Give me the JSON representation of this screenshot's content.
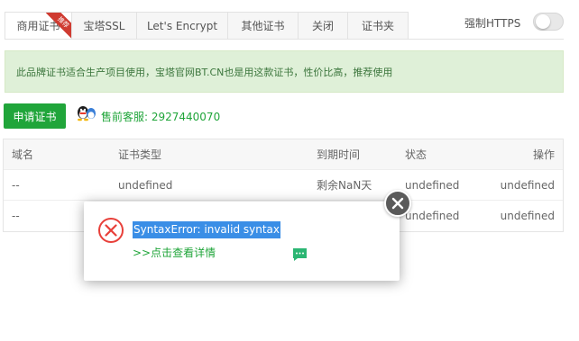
{
  "tabs": [
    {
      "label": "商用证书",
      "badge": "推荐",
      "active": true
    },
    {
      "label": "宝塔SSL"
    },
    {
      "label": "Let's Encrypt"
    },
    {
      "label": "其他证书"
    },
    {
      "label": "关闭"
    },
    {
      "label": "证书夹"
    }
  ],
  "https": {
    "label": "强制HTTPS",
    "enabled": false
  },
  "notice": "此品牌证书适合生产项目使用，宝塔官网BT.CN也是用这款证书，性价比高，推荐使用",
  "apply_button": "申请证书",
  "support": "售前客服: 2927440070",
  "table": {
    "headers": [
      "域名",
      "证书类型",
      "到期时间",
      "状态",
      "操作"
    ],
    "rows": [
      [
        "--",
        "undefined",
        "剩余NaN天",
        "undefined",
        "undefined"
      ],
      [
        "--",
        "",
        "",
        "undefined",
        "undefined"
      ]
    ]
  },
  "modal": {
    "error": "SyntaxError: invalid syntax",
    "detail_link": ">>点击查看详情"
  },
  "colors": {
    "brand_green": "#20a53a",
    "error_red": "#e8403a",
    "selection_blue": "#3a8ee6"
  }
}
